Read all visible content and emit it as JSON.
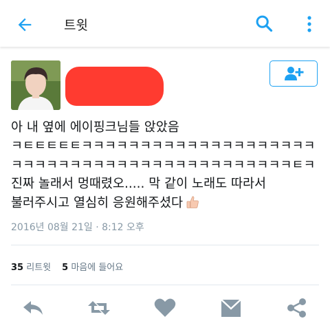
{
  "appbar": {
    "title": "트윗"
  },
  "tweet": {
    "lines": [
      "아 내 옆에 에이핑크님들 앉았음",
      "ㅋㅌㅌㅌㅌㅌㅋㅋㅋㅋㅋㅋㅋㅋㅋㅋㅋㅋㅋㅋㅋㅋㅋㅋㅋㅋ",
      "ㅋㅋㅋㅋㅋㅋㅋㅋㅋㅋㅋㅋㅋㅋㅋㅋㅋㅋㅋㅋㅋㅋㅋㅋㅌㅋ",
      "진짜 놀래서 멍때렸오..... 막 같이 노래도 따라서",
      "불러주시고 열심히 응원해주셨다"
    ],
    "timestamp": "2016년 08월 21일 · 8:12 오후"
  },
  "stats": {
    "retweets_count": "35",
    "retweets_label": "리트윗",
    "likes_count": "5",
    "likes_label": "마음에 들어요"
  },
  "colors": {
    "accent": "#1da1f2",
    "icon_gray": "#8899a6",
    "redaction": "#ff3b30"
  },
  "icons": [
    "back-arrow-icon",
    "search-icon",
    "more-vertical-icon",
    "follow-user-icon",
    "thumbs-up-emoji",
    "reply-icon",
    "retweet-icon",
    "heart-icon",
    "message-icon",
    "share-icon"
  ]
}
